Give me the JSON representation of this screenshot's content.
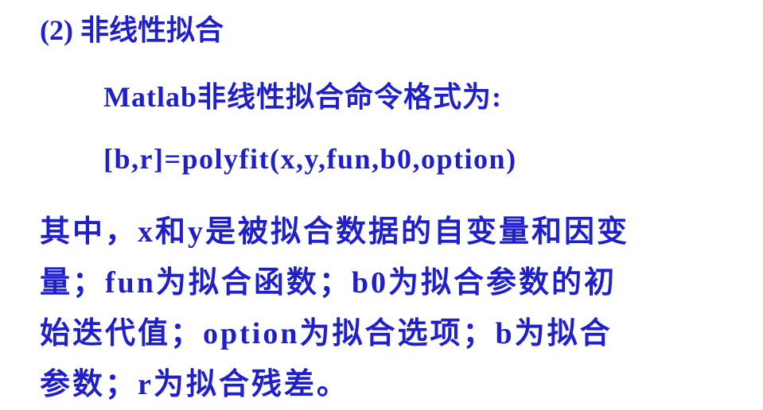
{
  "slide": {
    "heading": "(2) 非线性拟合",
    "subheading": "Matlab非线性拟合命令格式为:",
    "code": "[b,r]=polyfit(x,y,fun,b0,option)",
    "paragraph_lines": [
      "其中，x和y是被拟合数据的自变量和因变",
      "量；fun为拟合函数；b0为拟合参数的初",
      "始迭代值；option为拟合选项；b为拟合",
      "参数；r为拟合残差。"
    ],
    "text_color": "#1f1fcc",
    "background_color": "#ffffff"
  }
}
